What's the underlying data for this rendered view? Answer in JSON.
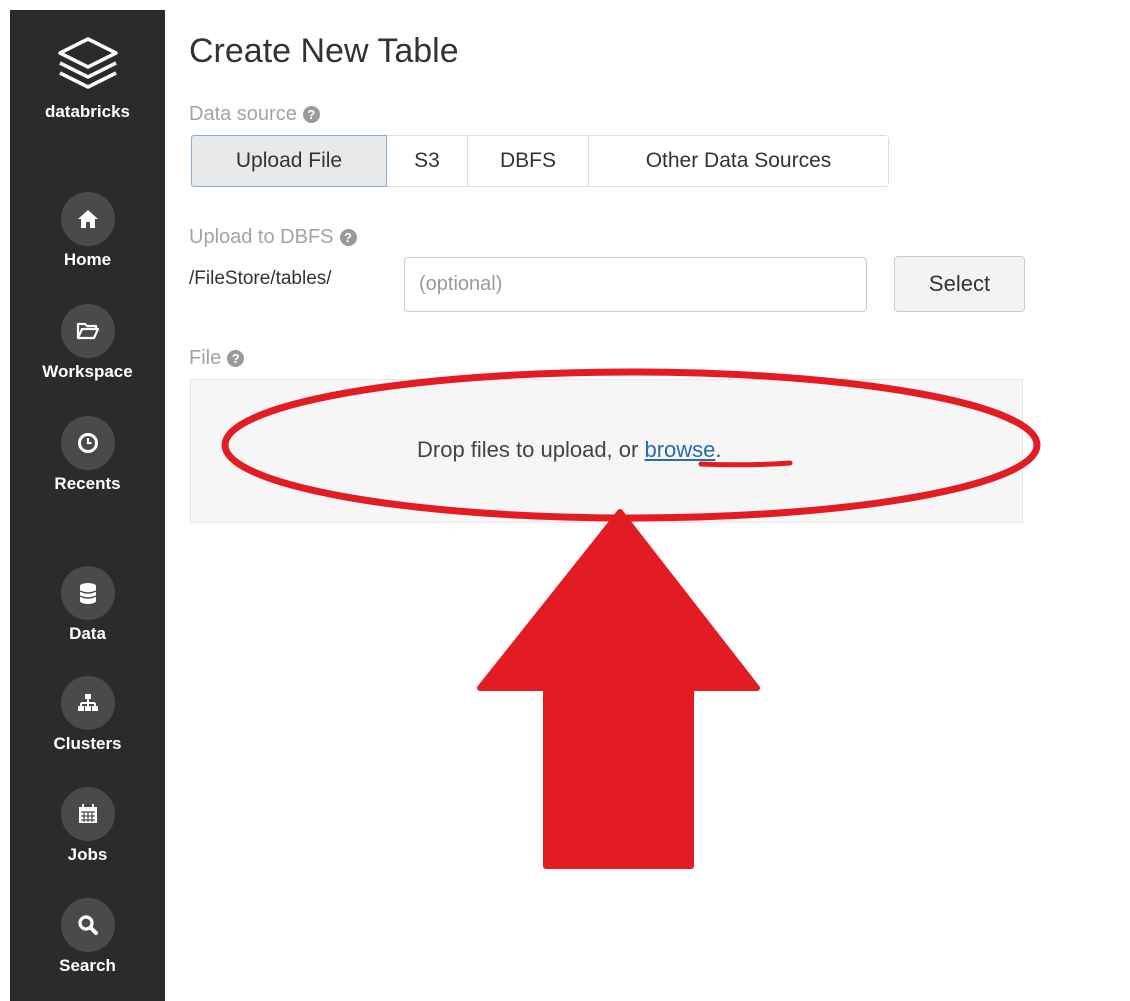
{
  "sidebar": {
    "brand": "databricks",
    "items": [
      {
        "label": "Home",
        "icon": "home-icon"
      },
      {
        "label": "Workspace",
        "icon": "folder-icon"
      },
      {
        "label": "Recents",
        "icon": "clock-icon"
      },
      {
        "label": "Data",
        "icon": "database-icon"
      },
      {
        "label": "Clusters",
        "icon": "sitemap-icon"
      },
      {
        "label": "Jobs",
        "icon": "calendar-icon"
      },
      {
        "label": "Search",
        "icon": "search-icon"
      }
    ]
  },
  "main": {
    "title": "Create New Table",
    "data_source": {
      "label": "Data source",
      "tabs": [
        "Upload File",
        "S3",
        "DBFS",
        "Other Data Sources"
      ],
      "active_tab": "Upload File"
    },
    "upload": {
      "label": "Upload to DBFS",
      "path_prefix": "/FileStore/tables/",
      "placeholder": "(optional)",
      "select_label": "Select"
    },
    "file": {
      "label": "File",
      "drop_text": "Drop files to upload, or",
      "browse_label": "browse",
      "trailing": "."
    }
  },
  "colors": {
    "sidebar_bg": "#2b2b2b",
    "link": "#2a69ad",
    "annotation_red": "#e31b23"
  }
}
